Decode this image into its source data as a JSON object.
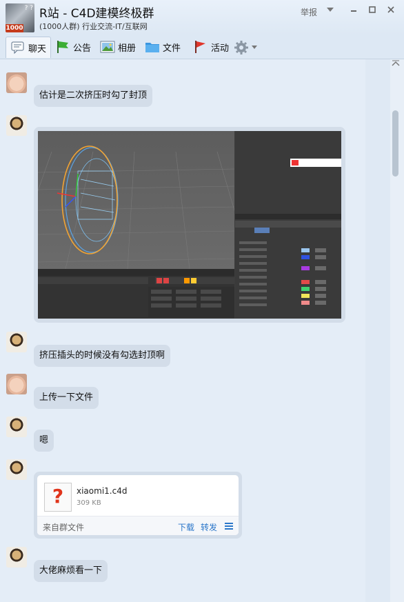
{
  "window": {
    "title": "R站 - C4D建模终极群",
    "subtitle": "(1000人群) 行业交流-IT/互联网",
    "avatar_count": "1000",
    "report_label": "举报"
  },
  "toolbar": {
    "tabs": [
      {
        "label": "聊天"
      },
      {
        "label": "公告"
      },
      {
        "label": "相册"
      },
      {
        "label": "文件"
      },
      {
        "label": "活动"
      }
    ]
  },
  "messages": [
    {
      "text": "估计是二次挤压时勾了封顶"
    },
    {
      "text": "挤压插头的时候没有勾选封顶啊"
    },
    {
      "text": "上传一下文件"
    },
    {
      "text": "嗯"
    },
    {
      "text": "大佬麻烦看一下"
    }
  ],
  "file": {
    "name": "xiaomi1.c4d",
    "size": "309 KB",
    "source": "来自群文件",
    "download_label": "下载",
    "forward_label": "转发",
    "icon_glyph": "?"
  },
  "colors": {
    "accent": "#2a76c9",
    "bubble": "#d3dde9",
    "background": "#e4edf7"
  }
}
